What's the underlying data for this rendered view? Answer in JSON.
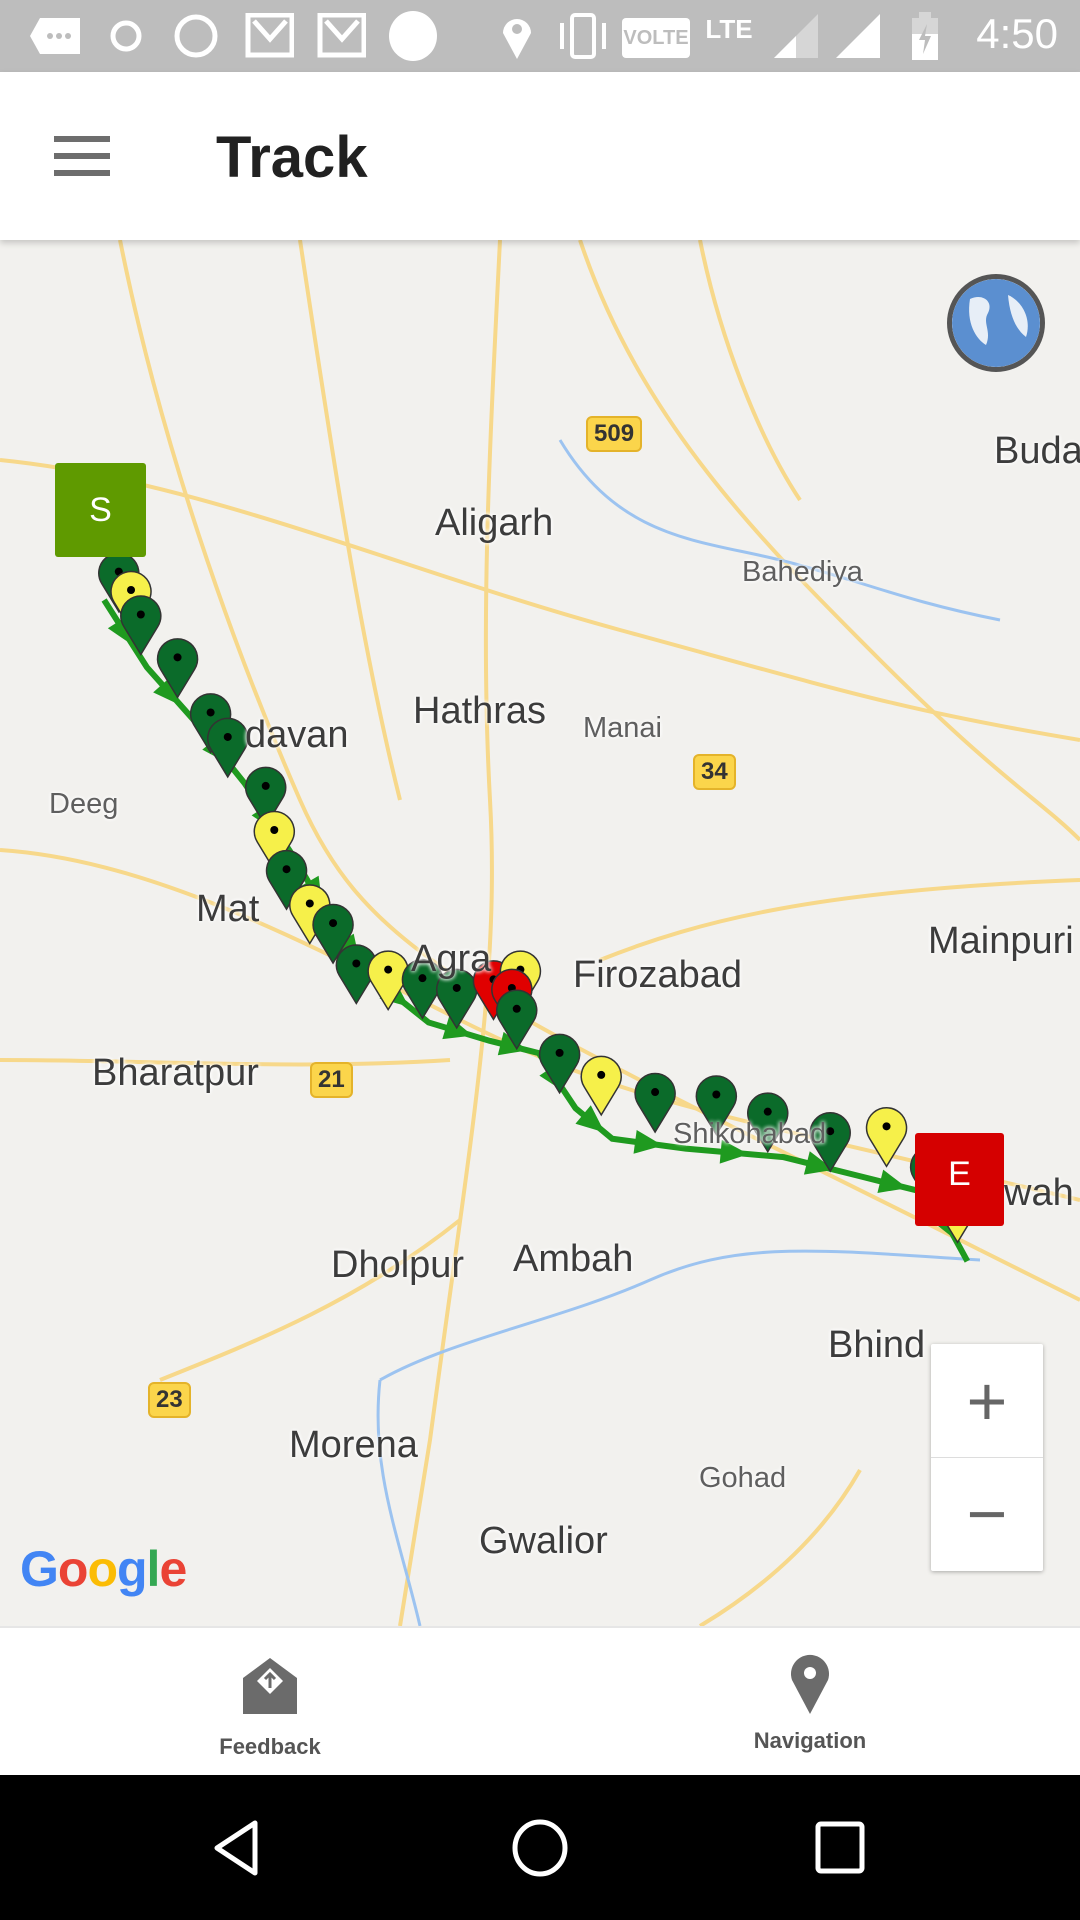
{
  "status_bar": {
    "icons": [
      "messages-icon",
      "shareit-icon",
      "whatsapp-icon",
      "gmail-icon",
      "gmail-icon",
      "circle-icon",
      "location-icon",
      "vibrate-icon",
      "volte-icon",
      "lte-icon",
      "signal-icon",
      "signal-icon",
      "battery-charging-icon"
    ],
    "volte": "VOLTE",
    "lte": "LTE",
    "time": "4:50"
  },
  "toolbar": {
    "title": "Track",
    "menu_icon": "hamburger-icon"
  },
  "map": {
    "labels": {
      "aligarh": "Aligarh",
      "bahediya": "Bahediya",
      "budaun": "Buda",
      "hathras": "Hathras",
      "manai": "Manai",
      "deeg": "Deeg",
      "vrindavan": "davan",
      "mathura": "Mat",
      "agra": "Agra",
      "firozabad": "Firozabad",
      "mainpuri": "Mainpuri",
      "bharatpur": "Bharatpur",
      "shikohabad": "Shikohabad",
      "etawah": "wah",
      "dholpur": "Dholpur",
      "ambah": "Ambah",
      "bhind": "Bhind",
      "morena": "Morena",
      "gohad": "Gohad",
      "gwalior": "Gwalior"
    },
    "highways": {
      "h509": "509",
      "h34": "34",
      "h21": "21",
      "h23": "23"
    },
    "start_marker": {
      "label": "S",
      "color": "#5f9a00"
    },
    "end_marker": {
      "label": "E",
      "color": "#d50000"
    },
    "marker_colors": {
      "green": "#0b6b2a",
      "yellow": "#f6f04a",
      "red": "#e00000"
    },
    "route_color": "#1f9a1f",
    "track_markers": [
      "green",
      "yellow",
      "green",
      "green",
      "green",
      "green",
      "green",
      "yellow",
      "green",
      "yellow",
      "green",
      "green",
      "yellow",
      "green",
      "green",
      "red",
      "yellow",
      "red",
      "green",
      "green",
      "yellow",
      "green",
      "green",
      "green",
      "green",
      "yellow",
      "green",
      "yellow"
    ],
    "zoom_in": "+",
    "zoom_out": "−",
    "google_logo": "Google"
  },
  "bottom_bar": {
    "feedback": {
      "label": "Feedback",
      "icon": "feedback-icon"
    },
    "navigation": {
      "label": "Navigation",
      "icon": "map-pin-icon"
    }
  },
  "nav_bar": {
    "back": "back-icon",
    "home": "home-icon",
    "recents": "recents-icon"
  }
}
